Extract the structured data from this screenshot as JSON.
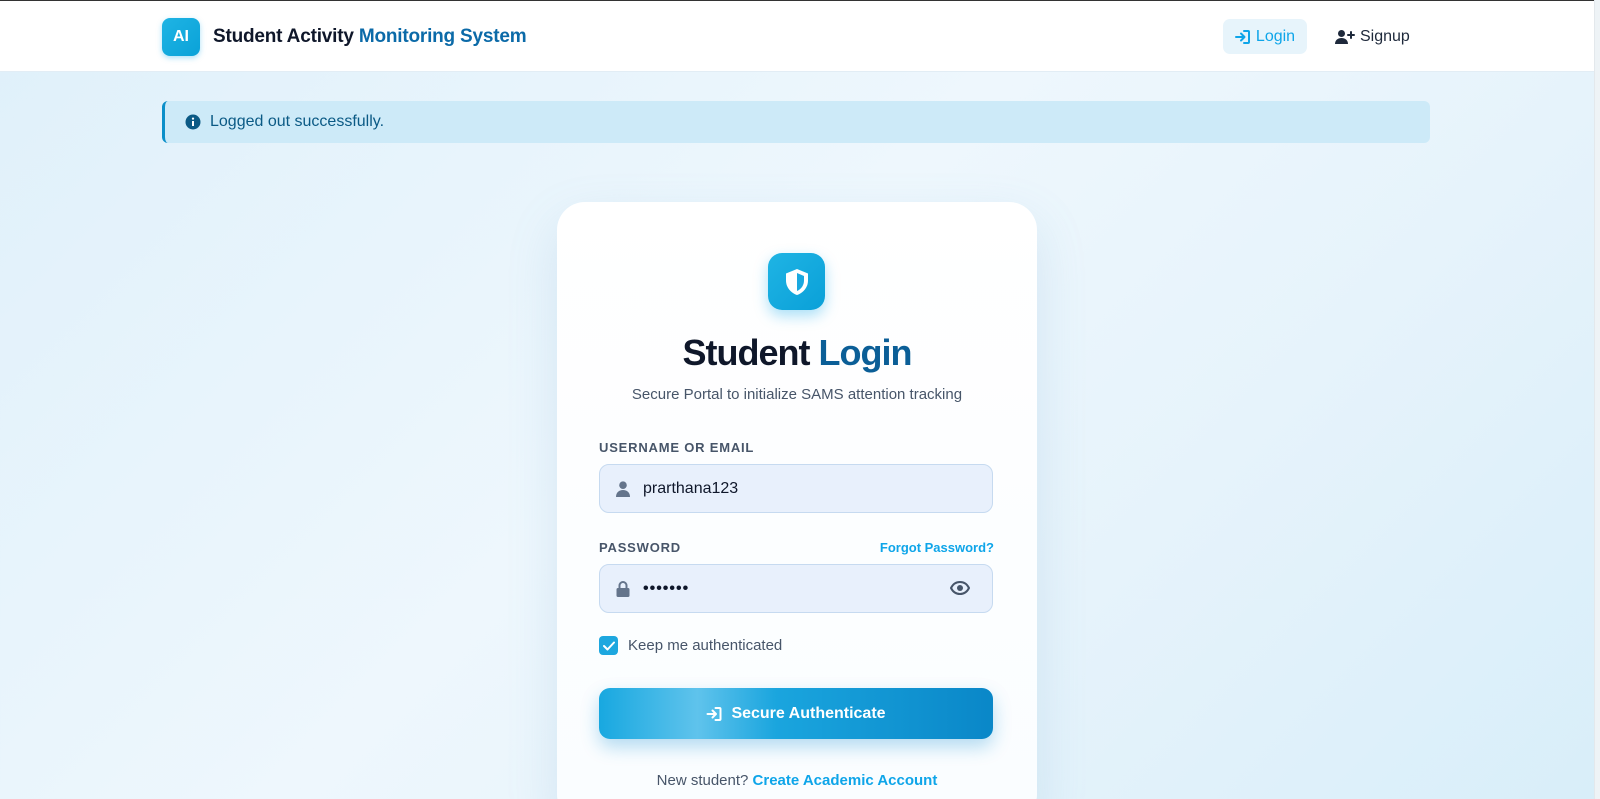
{
  "navbar": {
    "logo_text": "AI",
    "brand_part1": "Student Activity",
    "brand_part2": "Monitoring System",
    "login_label": "Login",
    "signup_label": "Signup"
  },
  "alert": {
    "message": "Logged out successfully."
  },
  "login_card": {
    "title_part1": "Student",
    "title_part2": "Login",
    "subtitle": "Secure Portal to initialize SAMS attention tracking",
    "username_label": "USERNAME OR EMAIL",
    "username_value": "prarthana123",
    "password_label": "PASSWORD",
    "forgot_label": "Forgot Password?",
    "password_masked": "•••••••",
    "remember_label": "Keep me authenticated",
    "remember_checked": true,
    "submit_label": "Secure Authenticate",
    "footer_text": "New student?",
    "footer_link": "Create Academic Account"
  },
  "colors": {
    "accent": "#0ea5e9",
    "brand_dark": "#0b5e97",
    "alert_bg": "#cdeaf8"
  },
  "icons": [
    "sign-in-icon",
    "user-plus-icon",
    "info-icon",
    "shield-icon",
    "user-icon",
    "lock-icon",
    "eye-icon",
    "check-icon"
  ]
}
